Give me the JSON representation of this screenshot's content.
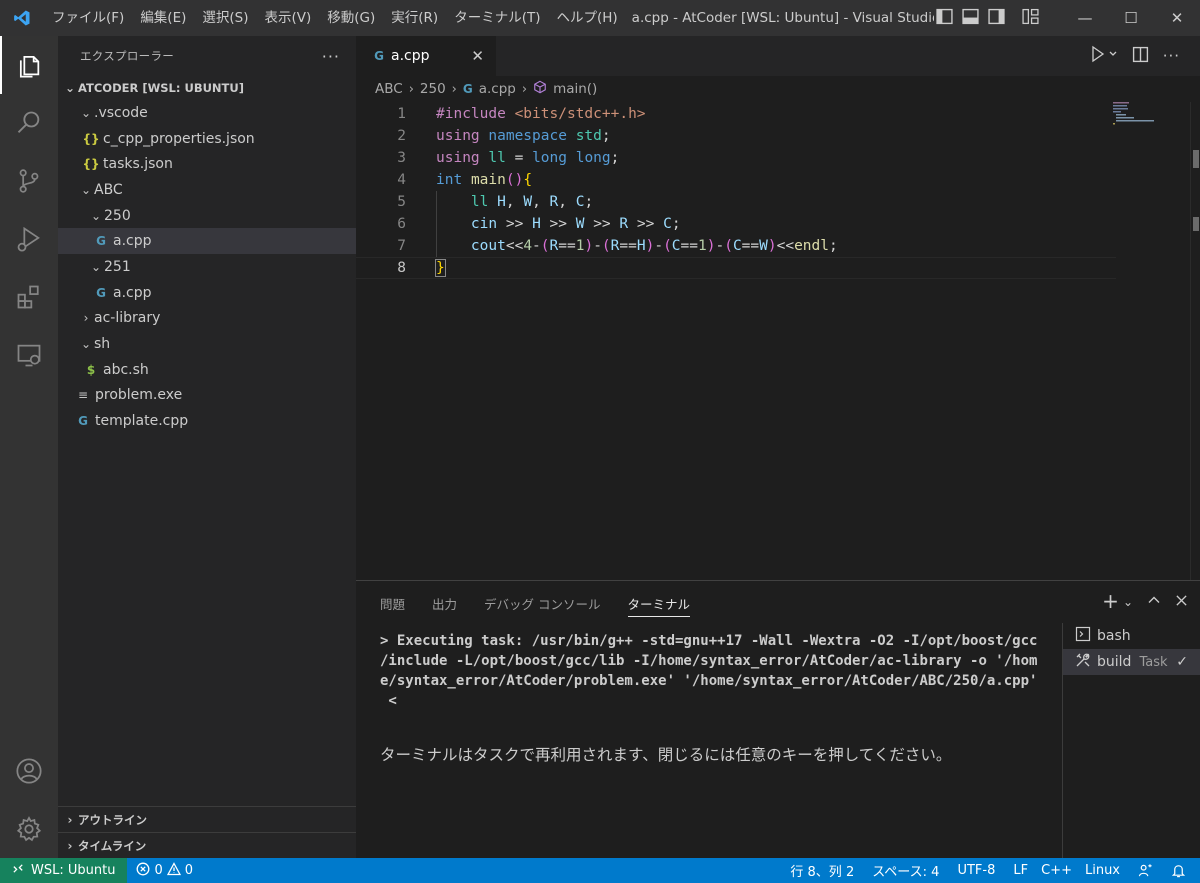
{
  "titlebar": {
    "menu": [
      "ファイル(F)",
      "編集(E)",
      "選択(S)",
      "表示(V)",
      "移動(G)",
      "実行(R)",
      "ターミナル(T)",
      "ヘルプ(H)"
    ],
    "window_title": "a.cpp - AtCoder [WSL: Ubuntu] - Visual Studio ...",
    "minimize": "—",
    "maximize": "☐",
    "close": "✕"
  },
  "sidebar": {
    "title": "エクスプローラー",
    "more": "···",
    "root": "ATCODER [WSL: UBUNTU]",
    "tree": [
      {
        "label": ".vscode",
        "chev": "⌄",
        "icon": "",
        "indent": 1
      },
      {
        "label": "c_cpp_properties.json",
        "chev": "",
        "icon": "{}",
        "indent": 2
      },
      {
        "label": "tasks.json",
        "chev": "",
        "icon": "{}",
        "indent": 2
      },
      {
        "label": "ABC",
        "chev": "⌄",
        "icon": "",
        "indent": 1
      },
      {
        "label": "250",
        "chev": "⌄",
        "icon": "",
        "indent": 2
      },
      {
        "label": "a.cpp",
        "chev": "",
        "icon": "G",
        "indent": 3
      },
      {
        "label": "251",
        "chev": "⌄",
        "icon": "",
        "indent": 2
      },
      {
        "label": "a.cpp",
        "chev": "",
        "icon": "G",
        "indent": 3
      },
      {
        "label": "ac-library",
        "chev": "›",
        "icon": "",
        "indent": 1
      },
      {
        "label": "sh",
        "chev": "⌄",
        "icon": "",
        "indent": 1
      },
      {
        "label": "abc.sh",
        "chev": "",
        "icon": "$",
        "indent": 2
      },
      {
        "label": "problem.exe",
        "chev": "",
        "icon": "≡",
        "indent": 1
      },
      {
        "label": "template.cpp",
        "chev": "",
        "icon": "G",
        "indent": 1
      }
    ],
    "outline": "アウトライン",
    "timeline": "タイムライン"
  },
  "editor": {
    "tab_label": "a.cpp",
    "tab_close": "✕",
    "breadcrumb": [
      "ABC",
      "250",
      "a.cpp",
      "main()"
    ],
    "line_numbers": [
      "1",
      "2",
      "3",
      "4",
      "5",
      "6",
      "7",
      "8"
    ],
    "lines": [
      "#include <bits/stdc++.h>",
      "using namespace std;",
      "using ll = long long;",
      "int main(){",
      "    ll H, W, R, C;",
      "    cin >> H >> W >> R >> C;",
      "    cout<<4-(R==1)-(R==H)-(C==1)-(C==W)<<endl;",
      "}"
    ]
  },
  "panel": {
    "tabs": [
      "問題",
      "出力",
      "デバッグ コンソール",
      "ターミナル"
    ],
    "terminal_lines": [
      "> Executing task: /usr/bin/g++ -std=gnu++17 -Wall -Wextra -O2 -I/opt/boost/gcc",
      "/include -L/opt/boost/gcc/lib -I/home/syntax_error/AtCoder/ac-library -o '/hom",
      "e/syntax_error/AtCoder/problem.exe' '/home/syntax_error/AtCoder/ABC/250/a.cpp'",
      " <"
    ],
    "terminal_message": "ターミナルはタスクで再利用されます、閉じるには任意のキーを押してください。",
    "terminals": [
      {
        "label": "bash",
        "task": "",
        "check": ""
      },
      {
        "label": "build",
        "task": "Task",
        "check": "✓"
      }
    ]
  },
  "statusbar": {
    "remote": "WSL: Ubuntu",
    "errors": "0",
    "warnings": "0",
    "position": "行 8、列 2",
    "spaces": "スペース: 4",
    "encoding": "UTF-8",
    "eol": "LF",
    "language": "C++",
    "os": "Linux"
  },
  "colors": {
    "accent": "#007acc",
    "remote": "#16825d",
    "editor_bg": "#1e1e1e",
    "sidebar_bg": "#252526"
  }
}
